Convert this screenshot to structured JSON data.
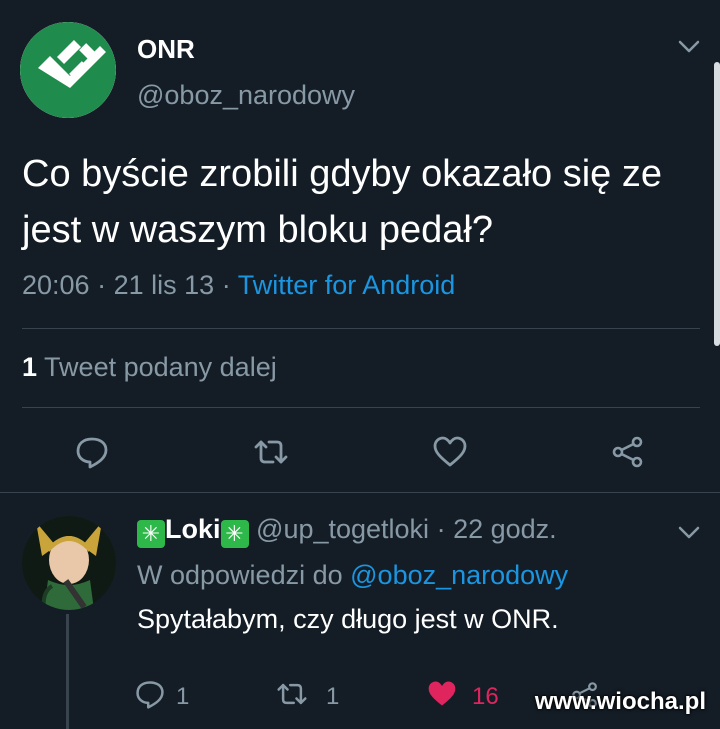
{
  "tweet": {
    "author_name": "ONR",
    "author_handle": "@oboz_narodowy",
    "text": "Co byście zrobili gdyby okazało się ze jest w waszym bloku pedał?",
    "time": "20:06",
    "date": "21 lis 13",
    "source": "Twitter for Android",
    "retweet_count": "1",
    "retweet_label": "Tweet podany dalej",
    "icons": [
      "reply-icon",
      "retweet-icon",
      "like-icon",
      "share-icon"
    ]
  },
  "reply": {
    "name": "Loki",
    "name_decoration": "✳",
    "handle": "@up_togetloki",
    "age": "22 godz.",
    "reply_prefix": "W odpowiedzi do",
    "reply_to": "@oboz_narodowy",
    "text": "Spytałabym, czy długo jest w ONR.",
    "reply_count": "1",
    "retweet_count": "1",
    "like_count": "16"
  },
  "watermark": "www.wiocha.pl",
  "colors": {
    "background": "#141d26",
    "muted": "#8899a6",
    "link": "#1b95e0",
    "like": "#e0245e",
    "onr_green": "#1f8b4c"
  }
}
